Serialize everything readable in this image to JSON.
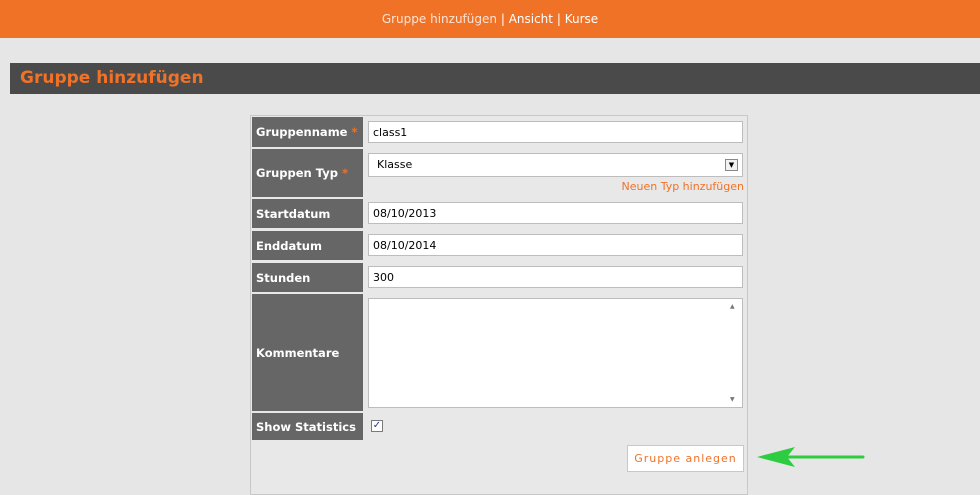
{
  "topnav": {
    "items": [
      "Gruppe hinzufügen",
      "Ansicht",
      "Kurse"
    ],
    "separator": "|"
  },
  "page_title": "Gruppe hinzufügen",
  "form": {
    "required_mark": "*",
    "group_name": {
      "label": "Gruppenname",
      "value": "class1"
    },
    "group_type": {
      "label": "Gruppen Typ",
      "value": "Klasse",
      "add_link": "Neuen Typ hinzufügen"
    },
    "start_date": {
      "label": "Startdatum",
      "value": "08/10/2013"
    },
    "end_date": {
      "label": "Enddatum",
      "value": "08/10/2014"
    },
    "hours": {
      "label": "Stunden",
      "value": "300"
    },
    "comments": {
      "label": "Kommentare",
      "value": ""
    },
    "show_statistics": {
      "label": "Show Statistics",
      "checked": true,
      "check_glyph": "✓"
    },
    "submit_label": "Gruppe anlegen"
  },
  "colors": {
    "accent": "#f07227",
    "label_bg": "#666666",
    "title_bar": "#4a4a4a",
    "annotation_arrow": "#2ecc40"
  },
  "icons": {
    "dropdown": "chevron-down-icon",
    "annotation": "arrow-left-icon"
  }
}
